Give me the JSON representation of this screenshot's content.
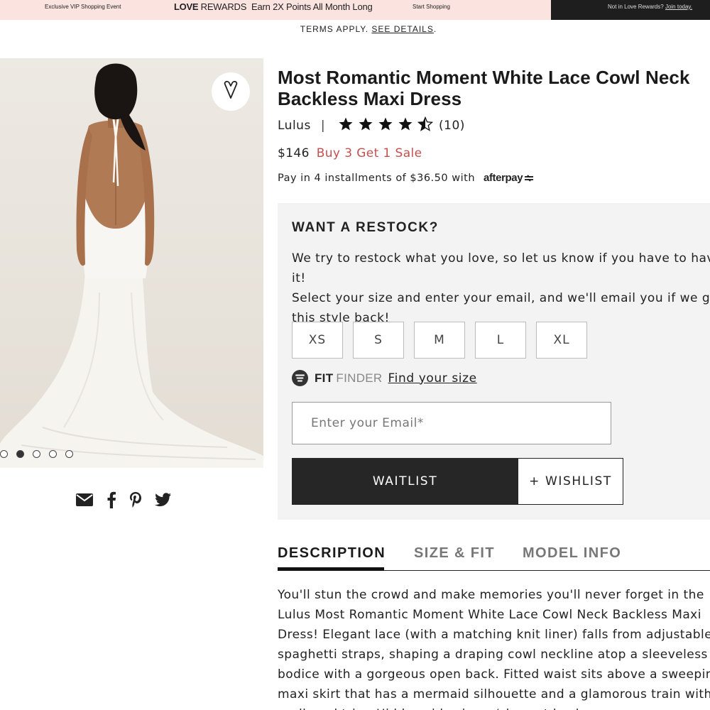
{
  "promo": {
    "left_text": "Exclusive VIP Shopping Event",
    "rewards_brand": "LOVE",
    "rewards_text": "REWARDS  Earn 2X Points All Month Long",
    "cta": "Start Shopping",
    "right_text": "Not in Love Rewards?",
    "right_link": "Join today."
  },
  "terms": {
    "text": "TERMS APPLY.",
    "link": "SEE DETAILS",
    "end": "."
  },
  "gallery": {
    "image_count": 5,
    "active_index": 1
  },
  "share_icons": [
    "email-icon",
    "facebook-icon",
    "pinterest-icon",
    "twitter-icon"
  ],
  "product": {
    "title": "Most Romantic Moment White Lace Cowl Neck Backless Maxi Dress",
    "brand": "Lulus",
    "separator": "|",
    "rating": 4.5,
    "review_count": "(10)",
    "price": "$146",
    "sale_label": "Buy 3 Get 1 Sale",
    "afterpay_text": "Pay in 4 installments of $36.50 with",
    "afterpay_brand": "afterpay"
  },
  "restock": {
    "title": "WANT A RESTOCK?",
    "text": "We try to restock what you love, so let us know if you have to have it!\nSelect your size and enter your email, and we'll email you if we get\nthis style back!",
    "sizes": [
      "XS",
      "S",
      "M",
      "L",
      "XL"
    ],
    "fit_label": "FIT",
    "finder_label": "FINDER",
    "fit_link": "Find your size",
    "email_placeholder": "Enter your Email*",
    "waitlist_label": "WAITLIST",
    "wishlist_label": "+ WISHLIST"
  },
  "tabs": {
    "description": "DESCRIPTION",
    "size_fit": "SIZE & FIT",
    "model_info": "MODEL INFO"
  },
  "description": "You'll stun the crowd and make memories you'll never forget in the\nLulus Most Romantic Moment White Lace Cowl Neck Backless Maxi\nDress! Elegant lace (with a matching knit liner) falls from adjustable\nspaghetti straps, shaping a draping cowl neckline atop a sleeveless\nbodice with a gorgeous open back. Fitted waist sits above a sweeping\nmaxi skirt that has a mermaid silhouette and a glamorous train with\nscalloped trim. Hidden side zipper/clasp at back.",
  "colors": {
    "promo_pink": "#fbe4e0",
    "promo_dark": "#1e1e1e",
    "sale_red": "#c45050",
    "panel_gray": "#f3f3f3",
    "button_dark": "#262626"
  }
}
